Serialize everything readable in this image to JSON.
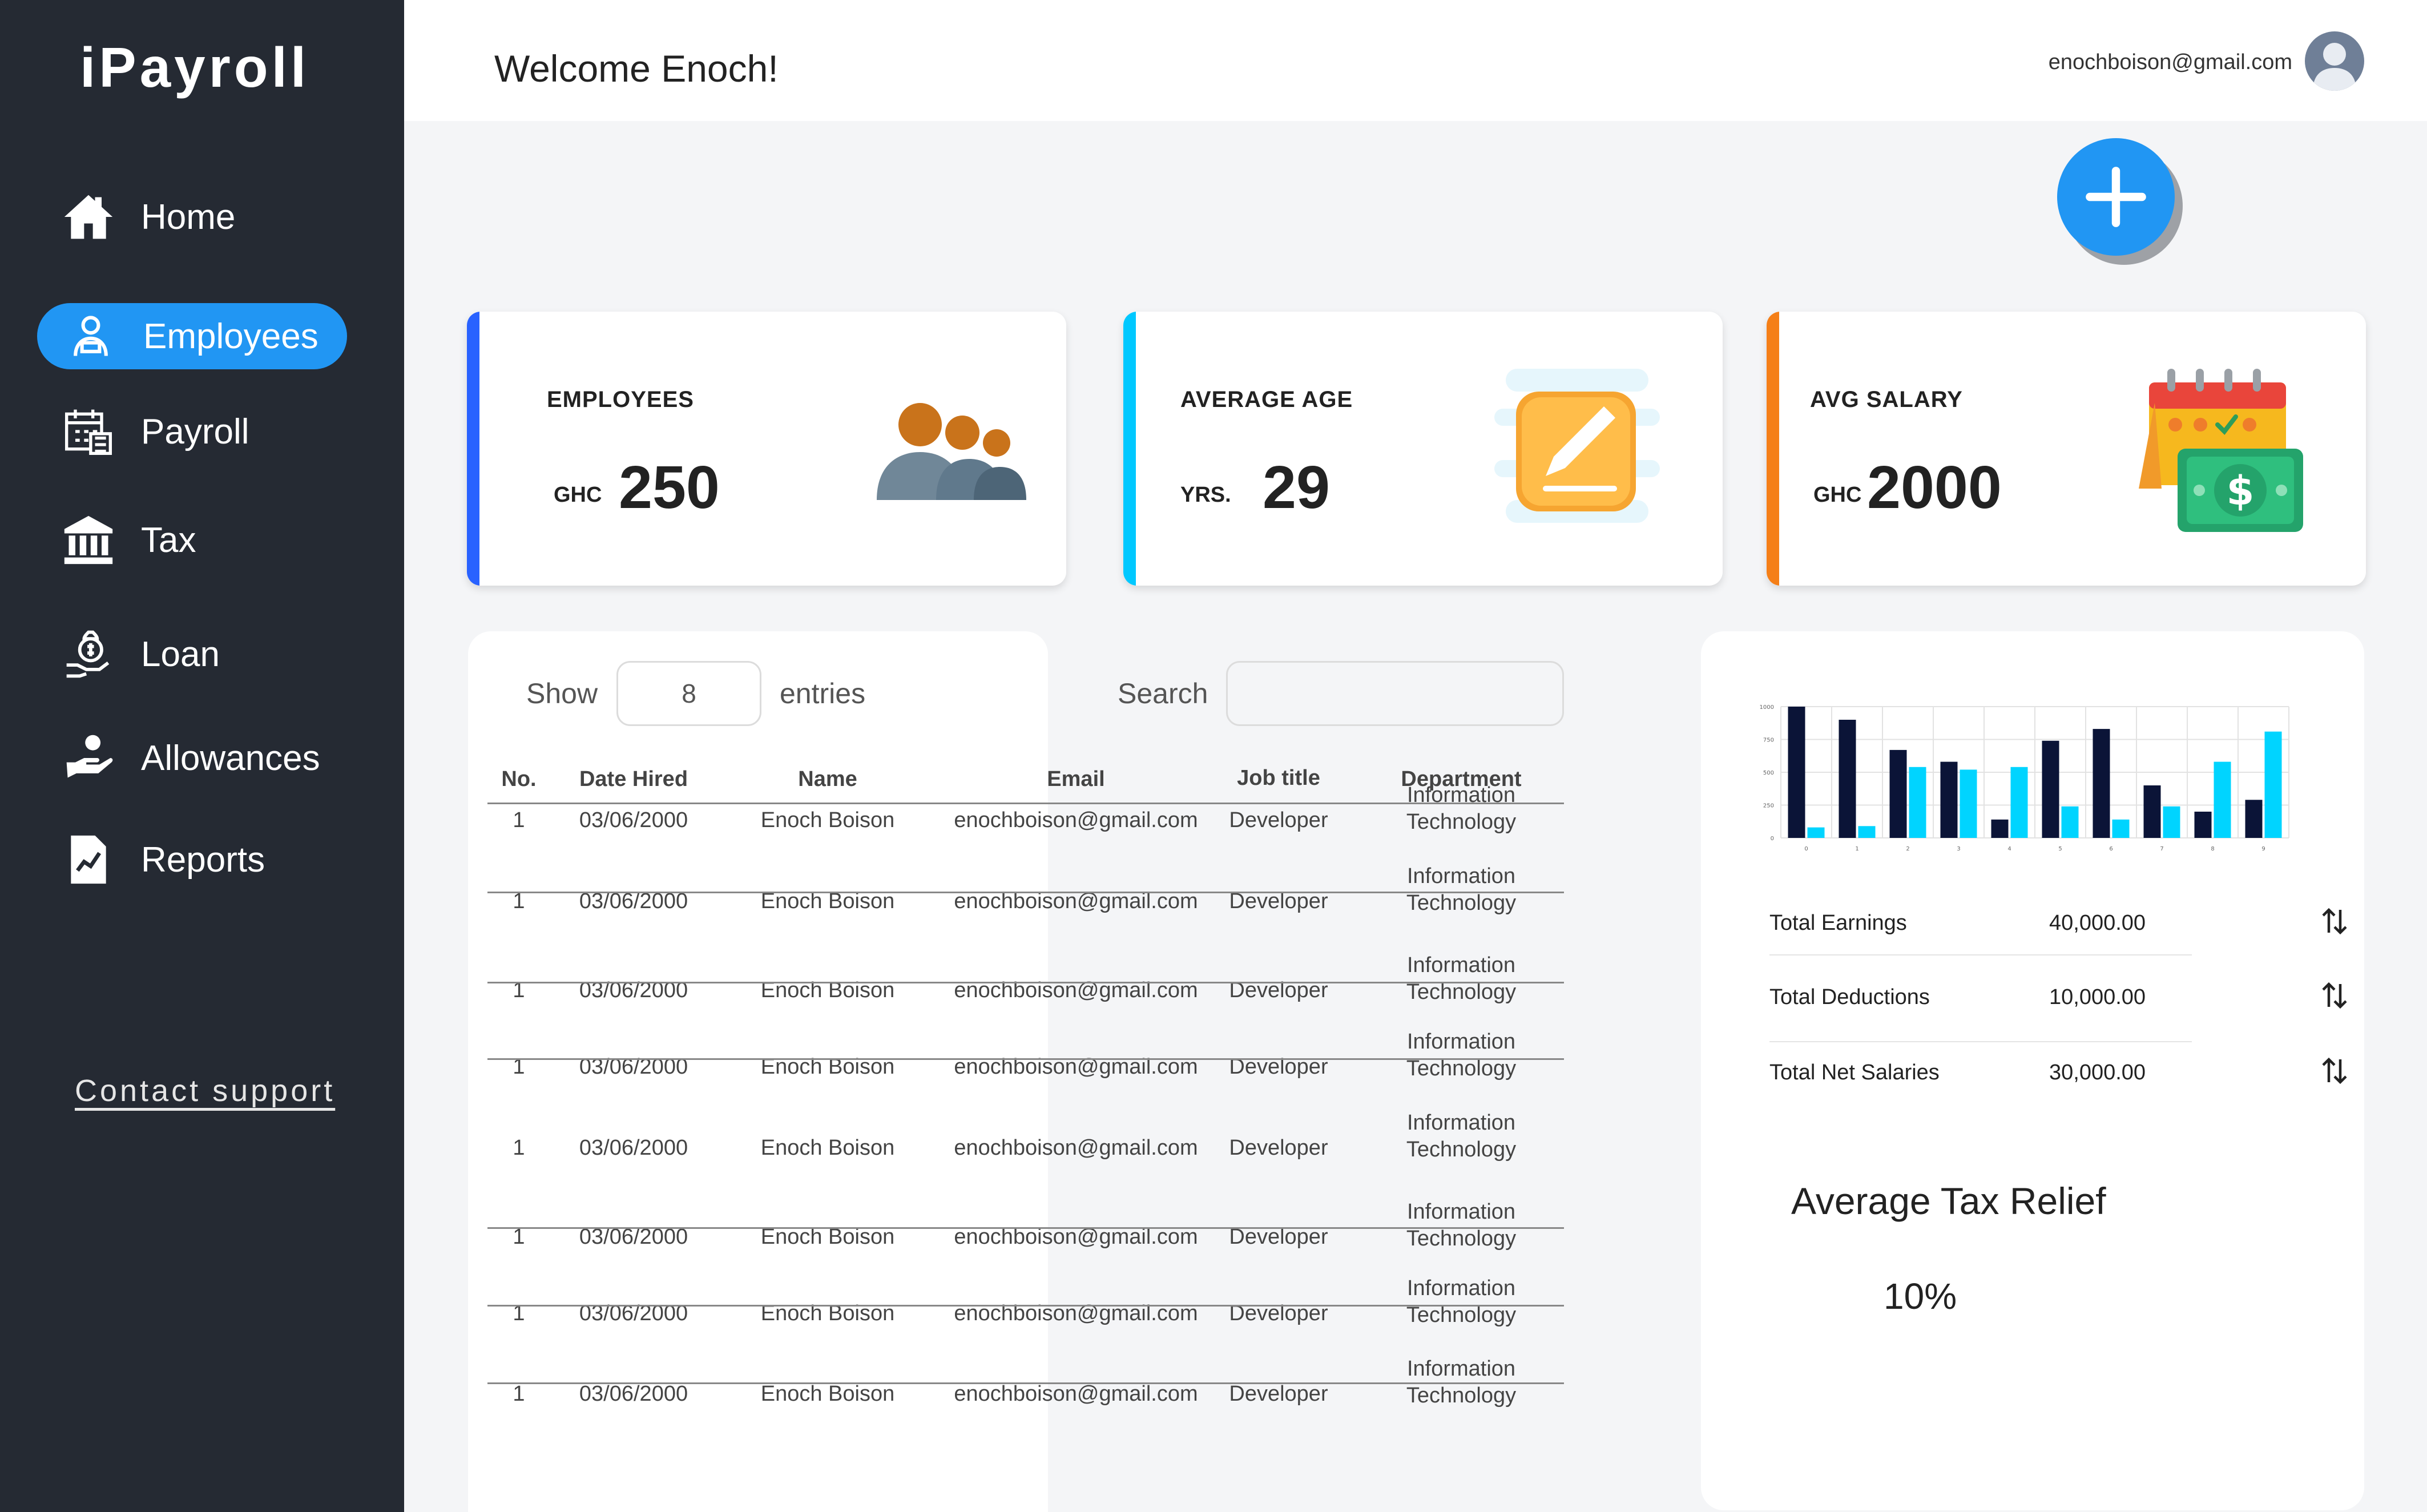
{
  "app": {
    "brand": "iPayroll"
  },
  "sidebar": {
    "items": [
      {
        "label": "Home",
        "icon": "home-icon",
        "active": false
      },
      {
        "label": "Employees",
        "icon": "employees-icon",
        "active": true
      },
      {
        "label": "Payroll",
        "icon": "payroll-icon",
        "active": false
      },
      {
        "label": "Tax",
        "icon": "bank-icon",
        "active": false
      },
      {
        "label": "Loan",
        "icon": "loan-icon",
        "active": false
      },
      {
        "label": "Allowances",
        "icon": "allowances-icon",
        "active": false
      },
      {
        "label": "Reports",
        "icon": "reports-icon",
        "active": false
      }
    ],
    "contact": "Contact support"
  },
  "header": {
    "welcome": "Welcome Enoch!",
    "email": "enochboison@gmail.com"
  },
  "stats": {
    "employees": {
      "label": "EMPLOYEES",
      "unit": "GHC",
      "value": "250",
      "accent": "#2962ff"
    },
    "age": {
      "label": "AVERAGE AGE",
      "unit": "YRS.",
      "value": "29",
      "accent": "#00c8ff"
    },
    "salary": {
      "label": "AVG SALARY",
      "unit": "GHC",
      "value": "2000",
      "accent": "#f57f17"
    }
  },
  "table": {
    "show_label": "Show",
    "entries_value": "8",
    "entries_label": "entries",
    "search_label": "Search",
    "search_value": "",
    "columns": [
      "No.",
      "Date Hired",
      "Name",
      "Email",
      "Job title",
      "Department"
    ],
    "rows": [
      {
        "no": "1",
        "date": "03/06/2000",
        "name": "Enoch Boison",
        "email": "enochboison@gmail.com",
        "job": "Developer",
        "dept1": "Information",
        "dept2": "Technology"
      },
      {
        "no": "1",
        "date": "03/06/2000",
        "name": "Enoch Boison",
        "email": "enochboison@gmail.com",
        "job": "Developer",
        "dept1": "Information",
        "dept2": "Technology"
      },
      {
        "no": "1",
        "date": "03/06/2000",
        "name": "Enoch Boison",
        "email": "enochboison@gmail.com",
        "job": "Developer",
        "dept1": "Information",
        "dept2": "Technology"
      },
      {
        "no": "1",
        "date": "03/06/2000",
        "name": "Enoch Boison",
        "email": "enochboison@gmail.com",
        "job": "Developer",
        "dept1": "Information",
        "dept2": "Technology"
      },
      {
        "no": "1",
        "date": "03/06/2000",
        "name": "Enoch Boison",
        "email": "enochboison@gmail.com",
        "job": "Developer",
        "dept1": "Information",
        "dept2": "Technology"
      },
      {
        "no": "1",
        "date": "03/06/2000",
        "name": "Enoch Boison",
        "email": "enochboison@gmail.com",
        "job": "Developer",
        "dept1": "Information",
        "dept2": "Technology"
      },
      {
        "no": "1",
        "date": "03/06/2000",
        "name": "Enoch Boison",
        "email": "enochboison@gmail.com",
        "job": "Developer",
        "dept1": "Information",
        "dept2": "Technology"
      },
      {
        "no": "1",
        "date": "03/06/2000",
        "name": "Enoch Boison",
        "email": "enochboison@gmail.com",
        "job": "Developer",
        "dept1": "Information",
        "dept2": "Technology"
      }
    ]
  },
  "summary": {
    "items": [
      {
        "label": "Total  Earnings",
        "value": "40,000.00"
      },
      {
        "label": "Total  Deductions",
        "value": "10,000.00"
      },
      {
        "label": "Total  Net Salaries",
        "value": "30,000.00"
      }
    ],
    "tax_title": "Average Tax Relief",
    "tax_value": "10%"
  },
  "chart_data": {
    "type": "bar",
    "categories": [
      "0",
      "1",
      "2",
      "3",
      "4",
      "5",
      "6",
      "7",
      "8",
      "9"
    ],
    "yticks": [
      "0",
      "250",
      "500",
      "750",
      "1000"
    ],
    "ylim": [
      0,
      1000
    ],
    "grid": true,
    "series": [
      {
        "color": "#0b1437",
        "values": [
          1000,
          900,
          670,
          580,
          140,
          740,
          830,
          400,
          200,
          290
        ]
      },
      {
        "color": "#00d4ff",
        "values": [
          80,
          90,
          540,
          520,
          540,
          240,
          140,
          240,
          580,
          810
        ]
      }
    ]
  }
}
